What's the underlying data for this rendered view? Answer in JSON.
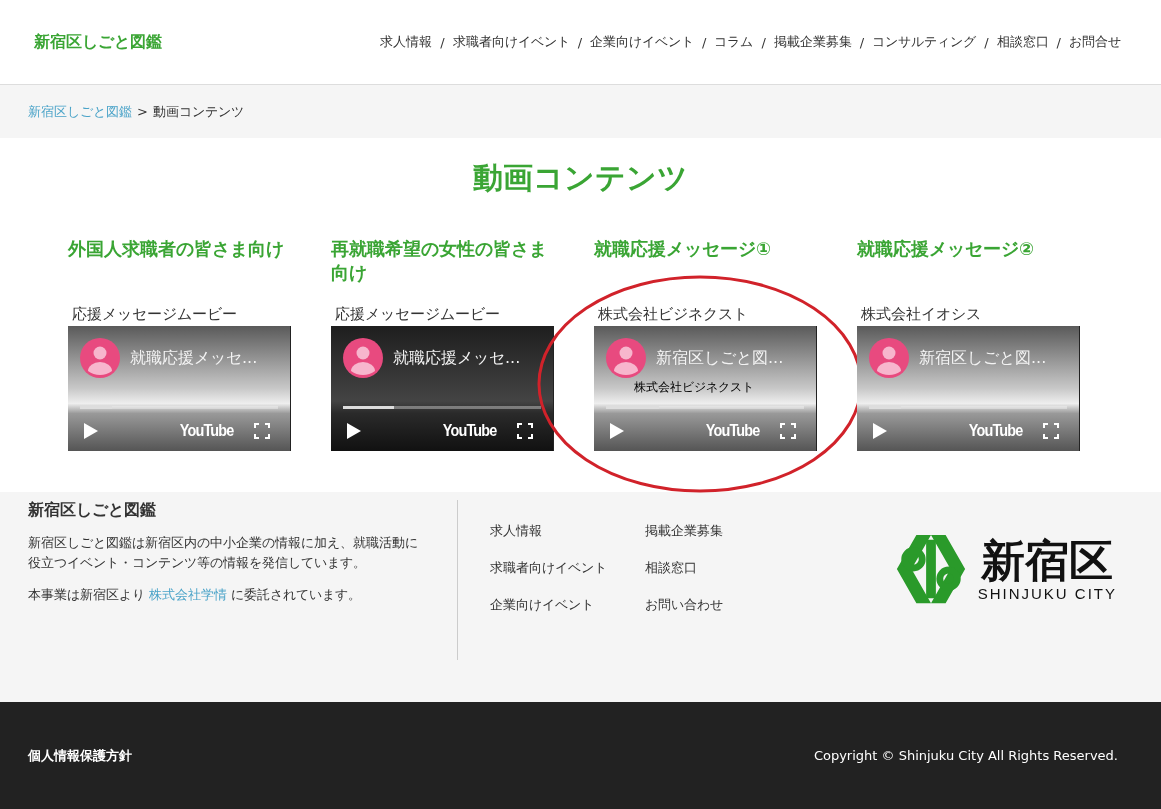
{
  "header": {
    "logo": "新宿区しごと図鑑",
    "nav": [
      "求人情報",
      "求職者向けイベント",
      "企業向けイベント",
      "コラム",
      "掲載企業募集",
      "コンサルティング",
      "相談窓口",
      "お問合せ"
    ],
    "separator": "/"
  },
  "breadcrumb": {
    "items": [
      "新宿区しごと図鑑"
    ],
    "current": "動画コンテンツ",
    "separator": ">"
  },
  "page_title": "動画コンテンツ",
  "videos": [
    {
      "heading": "外国人求職者の皆さま向け",
      "caption": "応援メッセージムービー",
      "video_title": "就職応援メッセ...",
      "kind": "light",
      "level": 0.16,
      "highlighted": false,
      "brand": "YouTube"
    },
    {
      "heading": "再就職希望の女性の皆さま向け",
      "caption": "応援メッセージムービー",
      "video_title": "就職応援メッセ...",
      "kind": "dark",
      "level": 0.26,
      "highlighted": false,
      "brand": "YouTube"
    },
    {
      "heading": "就職応援メッセージ①",
      "caption": "株式会社ビジネクスト",
      "video_title": "新宿区しごと図...",
      "overlay_text": "株式会社ビジネクスト",
      "kind": "light",
      "level": 0.27,
      "highlighted": true,
      "brand": "YouTube"
    },
    {
      "heading": "就職応援メッセージ②",
      "caption": "株式会社イオシス",
      "video_title": "新宿区しごと図...",
      "kind": "light",
      "level": 0.16,
      "highlighted": false,
      "brand": "YouTube"
    }
  ],
  "footer": {
    "title": "新宿区しごと図鑑",
    "description": "新宿区しごと図鑑は新宿区内の中小企業の情報に加え、就職活動に役立つイベント・コンテンツ等の情報を発信しています。",
    "notice_before": "本事業は新宿区より",
    "notice_link": "株式会社学情",
    "notice_after": "に委託されています。",
    "links": [
      "求人情報",
      "掲載企業募集",
      "求職者向けイベント",
      "相談窓口",
      "企業向けイベント",
      "お問い合わせ"
    ],
    "city_logo": {
      "name": "新宿区",
      "subtitle": "SHINJUKU CITY"
    }
  },
  "bottom_bar": {
    "privacy": "個人情報保護方針",
    "copyright": "Copyright © Shinjuku City All Rights Reserved."
  }
}
